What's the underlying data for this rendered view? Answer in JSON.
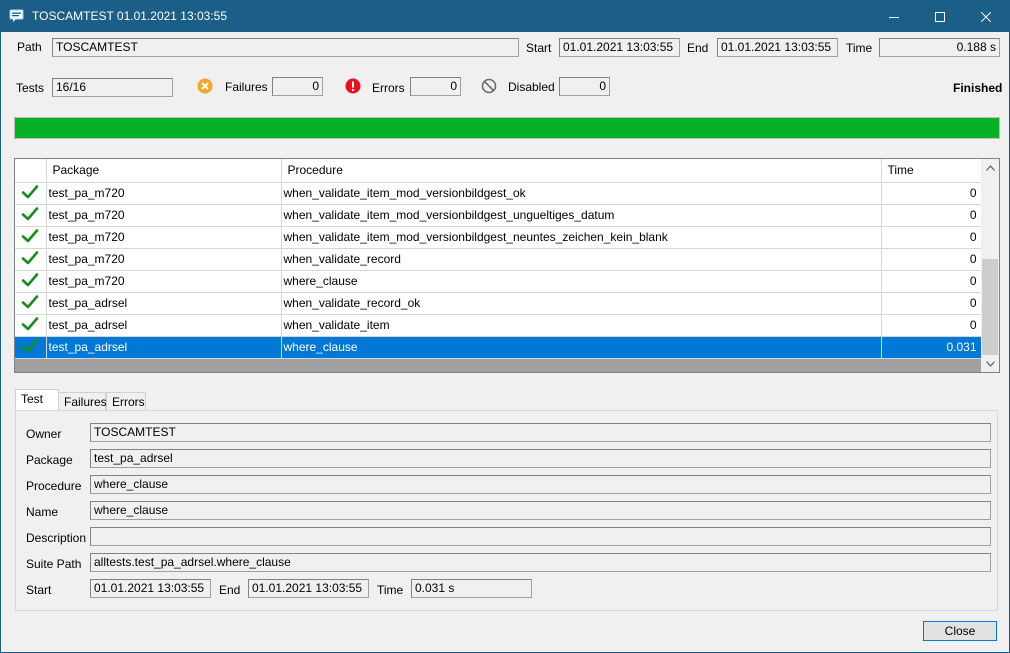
{
  "window": {
    "title": "TOSCAMTEST 01.01.2021 13:03:55"
  },
  "summary": {
    "path_label": "Path",
    "path_value": "TOSCAMTEST",
    "start_label": "Start",
    "start_value": "01.01.2021 13:03:55",
    "end_label": "End",
    "end_value": "01.01.2021 13:03:55",
    "time_label": "Time",
    "time_value": "0.188 s",
    "tests_label": "Tests",
    "tests_value": "16/16",
    "failures_label": "Failures",
    "failures_value": "0",
    "errors_label": "Errors",
    "errors_value": "0",
    "disabled_label": "Disabled",
    "disabled_value": "0",
    "status": "Finished",
    "progress_fraction": 1.0
  },
  "colors": {
    "progress": "#06b025",
    "selection": "#0078d7",
    "titlebar": "#1b5e88",
    "check": "#1a8c1a"
  },
  "grid": {
    "columns": [
      "",
      "Package",
      "Procedure",
      "Time"
    ],
    "rows": [
      {
        "package": "test_pa_m720",
        "procedure": "when_validate_item_mod_versionbildgest_ok",
        "time": "0",
        "icon": "check-icon"
      },
      {
        "package": "test_pa_m720",
        "procedure": "when_validate_item_mod_versionbildgest_ungueltiges_datum",
        "time": "0",
        "icon": "check-icon"
      },
      {
        "package": "test_pa_m720",
        "procedure": "when_validate_item_mod_versionbildgest_neuntes_zeichen_kein_blank",
        "time": "0",
        "icon": "check-icon"
      },
      {
        "package": "test_pa_m720",
        "procedure": "when_validate_record",
        "time": "0",
        "icon": "check-icon"
      },
      {
        "package": "test_pa_m720",
        "procedure": "where_clause",
        "time": "0",
        "icon": "check-icon"
      },
      {
        "package": "test_pa_adrsel",
        "procedure": "when_validate_record_ok",
        "time": "0",
        "icon": "check-icon"
      },
      {
        "package": "test_pa_adrsel",
        "procedure": "when_validate_item",
        "time": "0",
        "icon": "check-icon"
      },
      {
        "package": "test_pa_adrsel",
        "procedure": "where_clause",
        "time": "0.031",
        "icon": "check-icon",
        "selected": true
      }
    ]
  },
  "tabs": [
    "Test",
    "Failures",
    "Errors"
  ],
  "details": {
    "owner_label": "Owner",
    "owner_value": "TOSCAMTEST",
    "package_label": "Package",
    "package_value": "test_pa_adrsel",
    "procedure_label": "Procedure",
    "procedure_value": "where_clause",
    "name_label": "Name",
    "name_value": "where_clause",
    "description_label": "Description",
    "description_value": "",
    "suite_path_label": "Suite Path",
    "suite_path_value": "alltests.test_pa_adrsel.where_clause",
    "start_label": "Start",
    "start_value": "01.01.2021 13:03:55",
    "end_label": "End",
    "end_value": "01.01.2021 13:03:55",
    "time_label": "Time",
    "time_value": "0.031 s"
  },
  "buttons": {
    "close": "Close"
  }
}
